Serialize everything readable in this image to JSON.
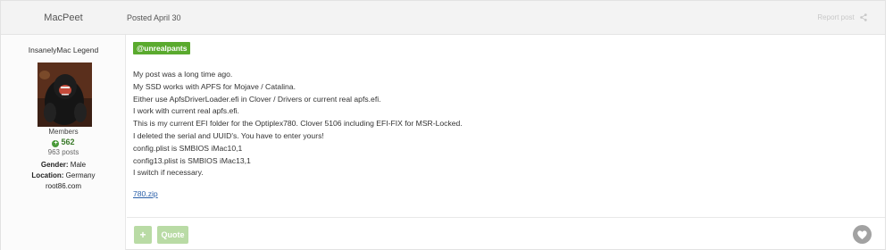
{
  "post": {
    "author": "MacPeet",
    "posted": "Posted April 30",
    "share_label": "Report post",
    "author_panel": {
      "rank_title": "InsanelyMac Legend",
      "group": "Members",
      "reputation": "562",
      "post_count": "963 posts",
      "gender_label": "Gender:",
      "gender_value": "Male",
      "location_label": "Location:",
      "location_value": "Germany",
      "website": "root86.com"
    },
    "mention": "@unrealpants",
    "lines": [
      "My post was a long time ago.",
      "My SSD works with APFS for Mojave / Catalina.",
      "Either use ApfsDriverLoader.efi in Clover / Drivers or current real apfs.efi.",
      "I work with current real apfs.efi.",
      "This is my current EFI folder for the Optiplex780. Clover 5106 including EFI-FIX for MSR-Locked.",
      "I deleted the serial and UUID's. You have to enter yours!",
      "config.plist is SMBIOS iMac10,1",
      "config13.plist is SMBIOS iMac13,1",
      "I switch if necessary."
    ],
    "attachment": "780.zip",
    "buttons": {
      "plus": "+",
      "quote": "Quote"
    }
  },
  "colors": {
    "accent_green": "#5aaa2e",
    "button_green": "#b9dba5",
    "link_blue": "#2a5fa8"
  },
  "icons": {
    "share": "share-icon",
    "reputation": "plus-circle-icon",
    "like": "heart-icon",
    "avatar": "gorilla-avatar"
  }
}
